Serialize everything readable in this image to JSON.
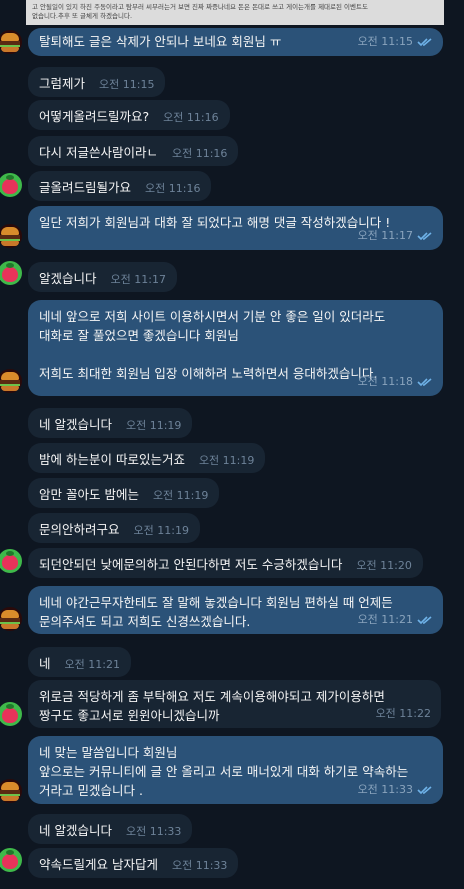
{
  "reply_preview": {
    "line1": "고 안될일이 있지 하진 주동이라고 탐부러 씨부러는거 보면 진짜 짜증나네요 돈은 돈대로 쓰고 게이는개를 제대로된 이벤트도",
    "line2": "없습니다.추후 또 글체게 하겠습니다."
  },
  "messages": [
    {
      "dir": "out",
      "lines": [
        "탈퇴해도 글은 삭제가 안되나 보네요 회원님 ㅠ"
      ],
      "time": "오전 11:15",
      "read": true,
      "avatar": "burger"
    },
    {
      "dir": "in",
      "lines": [
        "그럼제가"
      ],
      "time": "오전 11:15"
    },
    {
      "dir": "in",
      "lines": [
        "어떻게올려드릴까요?"
      ],
      "time": "오전 11:16"
    },
    {
      "dir": "in",
      "lines": [
        "다시 저글쓴사람이라ㄴ"
      ],
      "time": "오전 11:16"
    },
    {
      "dir": "in",
      "lines": [
        "글올려드림될가요"
      ],
      "time": "오전 11:16",
      "avatar": "berry"
    },
    {
      "dir": "out",
      "lines": [
        "일단 저희가 회원님과 대화 잘 되었다고 해명 댓글 작성하겠습니다 !"
      ],
      "time": "오전 11:17",
      "read": true,
      "avatar": "burger"
    },
    {
      "dir": "in",
      "lines": [
        "알겠습니다"
      ],
      "time": "오전 11:17",
      "avatar": "berry"
    },
    {
      "dir": "out",
      "lines": [
        "네네 앞으로 저희 사이트 이용하시면서 기분 안 좋은 일이 있더라도",
        "대화로 잘 풀었으면 좋겠습니다 회원님",
        "",
        "저희도 최대한 회원님 입장 이해하려 노력하면서 응대하겠습니다."
      ],
      "time": "오전 11:18",
      "read": true,
      "avatar": "burger"
    },
    {
      "dir": "in",
      "lines": [
        "네 알겠습니다"
      ],
      "time": "오전 11:19"
    },
    {
      "dir": "in",
      "lines": [
        "밤에 하는분이 따로있는거죠"
      ],
      "time": "오전 11:19"
    },
    {
      "dir": "in",
      "lines": [
        "암만 꼴아도 밤에는"
      ],
      "time": "오전 11:19"
    },
    {
      "dir": "in",
      "lines": [
        "문의안하려구요"
      ],
      "time": "오전 11:19"
    },
    {
      "dir": "in",
      "lines": [
        "되던안되던 낮에문의하고 안된다하면 저도 수긍하겠습니다"
      ],
      "time": "오전 11:20",
      "avatar": "berry"
    },
    {
      "dir": "out",
      "lines": [
        "네네 야간근무자한테도 잘 말해 놓겠습니다 회원님 편하실 때 언제든",
        "문의주셔도 되고 저희도 신경쓰겠습니다."
      ],
      "time": "오전 11:21",
      "read": true,
      "avatar": "burger"
    },
    {
      "dir": "in",
      "lines": [
        "네"
      ],
      "time": "오전 11:21"
    },
    {
      "dir": "in",
      "lines": [
        "위로금 적당하게 좀 부탁해요 저도 계속이용해야되고 제가이용하면",
        "짱구도 좋고서로 윈윈아니겠습니까"
      ],
      "time": "오전 11:22",
      "avatar": "berry"
    },
    {
      "dir": "out",
      "lines": [
        "네 맞는 말씀입니다 회원님",
        "앞으로는 커뮤니티에 글 안 올리고 서로 매너있게 대화 하기로 약속하는",
        "거라고 믿겠습니다 ."
      ],
      "time": "오전 11:33",
      "read": true,
      "avatar": "burger"
    },
    {
      "dir": "in",
      "lines": [
        "네 알겠습니다"
      ],
      "time": "오전 11:33"
    },
    {
      "dir": "in",
      "lines": [
        "약속드릴게요 남자답게"
      ],
      "time": "오전 11:33",
      "avatar": "berry"
    }
  ]
}
